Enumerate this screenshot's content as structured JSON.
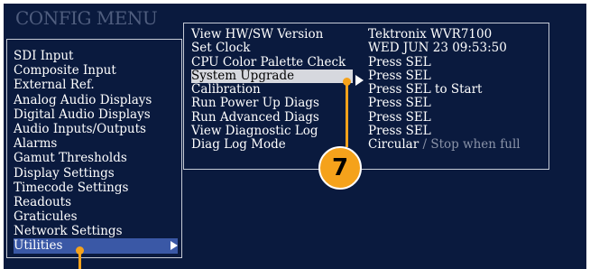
{
  "menu": {
    "title": "CONFIG MENU",
    "items": [
      {
        "label": "SDI Input"
      },
      {
        "label": "Composite Input"
      },
      {
        "label": "External Ref."
      },
      {
        "label": "Analog Audio Displays"
      },
      {
        "label": "Digital Audio Displays"
      },
      {
        "label": "Audio Inputs/Outputs"
      },
      {
        "label": "Alarms"
      },
      {
        "label": "Gamut Thresholds"
      },
      {
        "label": "Display Settings"
      },
      {
        "label": "Timecode Settings"
      },
      {
        "label": "Readouts"
      },
      {
        "label": "Graticules"
      },
      {
        "label": "Network Settings"
      },
      {
        "label": "Utilities"
      }
    ],
    "selected_index": 13
  },
  "submenu": {
    "items": [
      {
        "label": "View HW/SW Version",
        "value": "Tektronix WVR7100"
      },
      {
        "label": "Set Clock",
        "value": "WED JUN 23 09:53:50"
      },
      {
        "label": "CPU Color Palette Check",
        "value": "Press SEL"
      },
      {
        "label": "System Upgrade",
        "value": "Press SEL"
      },
      {
        "label": "Calibration",
        "value": "Press SEL to Start"
      },
      {
        "label": "Run Power Up Diags",
        "value": "Press SEL"
      },
      {
        "label": "Run Advanced Diags",
        "value": "Press SEL"
      },
      {
        "label": "View Diagnostic Log",
        "value": "Press SEL"
      },
      {
        "label": "Diag Log Mode",
        "value": "Circular",
        "value_dim": " / Stop when full"
      }
    ],
    "selected_index": 3
  },
  "callout": {
    "number": "7"
  },
  "colors": {
    "background": "#0a1a3e",
    "selection_left": "#3a58a6",
    "selection_right": "#d6d8de",
    "callout": "#f5a21b",
    "dim_text": "#8a93a8"
  }
}
